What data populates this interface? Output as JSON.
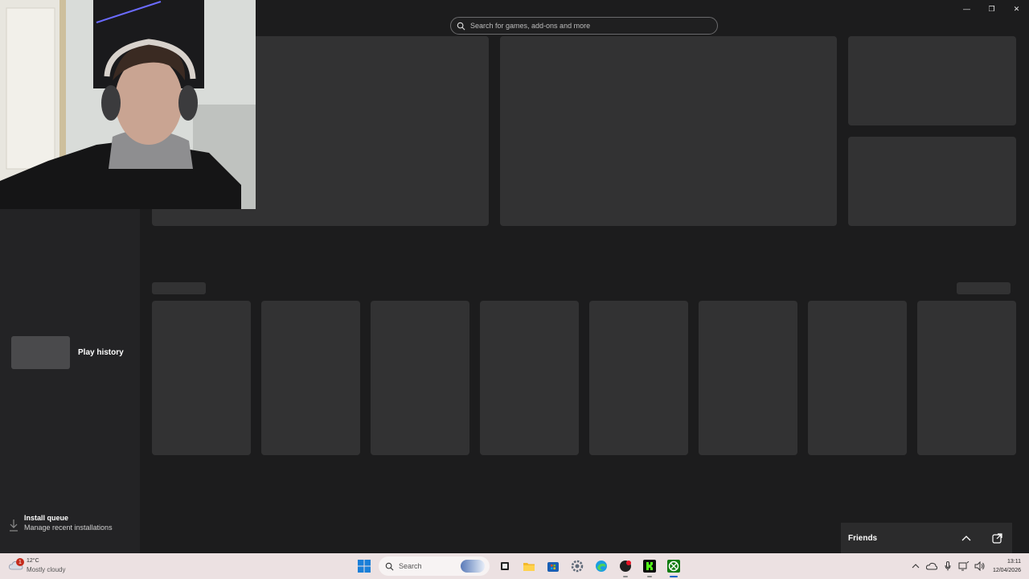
{
  "search": {
    "placeholder": "Search for games, add-ons and more"
  },
  "window": {
    "minimize": "—",
    "restore": "❐",
    "close": "✕"
  },
  "sidebar": {
    "play_history": "Play history",
    "install_queue": {
      "title": "Install queue",
      "subtitle": "Manage recent installations"
    }
  },
  "friends": {
    "label": "Friends"
  },
  "taskbar": {
    "weather": {
      "temp": "12°C",
      "condition": "Mostly cloudy",
      "badge": "1"
    },
    "search_label": "Search",
    "clock": {
      "time": "13:11",
      "date": "12/04/2026"
    },
    "pinned": [
      "start-icon",
      "search-icon",
      "task-view-icon",
      "file-explorer-icon",
      "microsoft-store-icon",
      "settings-icon",
      "edge-icon",
      "app-icon",
      "kick-icon",
      "xbox-icon"
    ]
  },
  "colors": {
    "background": "#1c1c1d",
    "sidebar": "#232325",
    "skeleton": "#323233",
    "taskbar": "#ece1e2",
    "xbox_green": "#107c10",
    "kick_green": "#53fc18"
  }
}
